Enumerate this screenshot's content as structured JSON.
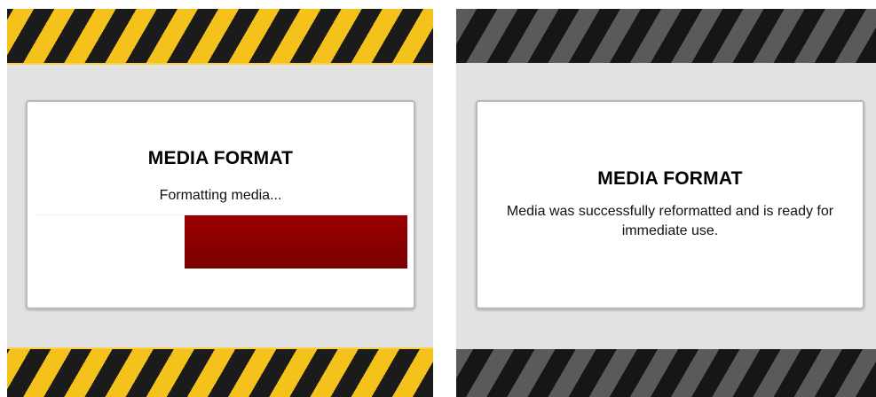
{
  "screens": [
    {
      "title": "MEDIA FORMAT",
      "message": "Formatting media...",
      "progress_fraction": 0.6,
      "theme": "yellow"
    },
    {
      "title": "MEDIA FORMAT",
      "message": "Media was successfully reformatted and is ready for immediate use.",
      "theme": "gray"
    }
  ],
  "colors": {
    "hazard_yellow": "#f4c21a",
    "hazard_black": "#1b1b1b",
    "hazard_gray": "#5a5a5a",
    "progress_red": "#8b0000",
    "panel_background": "#e2e2e2"
  }
}
